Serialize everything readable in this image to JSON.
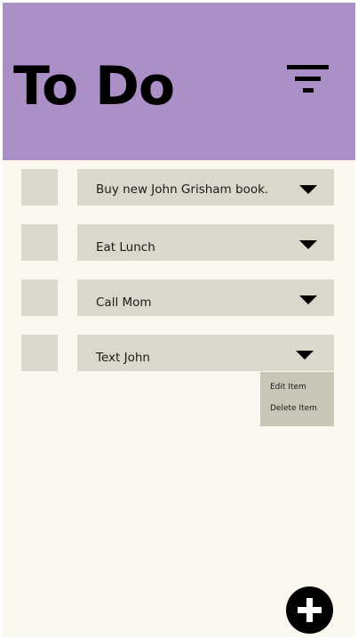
{
  "header": {
    "title": "To Do",
    "filter_icon": "filter-icon"
  },
  "items": [
    {
      "label": "Buy new John Grisham book.",
      "checked": false,
      "expanded": false
    },
    {
      "label": "Eat Lunch",
      "checked": false,
      "expanded": false
    },
    {
      "label": "Call Mom",
      "checked": false,
      "expanded": false
    },
    {
      "label": "Text John",
      "checked": false,
      "expanded": true
    }
  ],
  "item_menu": {
    "edit_label": "Edit Item",
    "delete_label": "Delete Item"
  },
  "add_button": {
    "icon": "plus-icon"
  },
  "colors": {
    "header_bg": "#ab8fc7",
    "page_bg": "#faf7ef",
    "item_bg": "#dbd8cb",
    "menu_bg": "#c9c6b7",
    "text": "#000000"
  }
}
